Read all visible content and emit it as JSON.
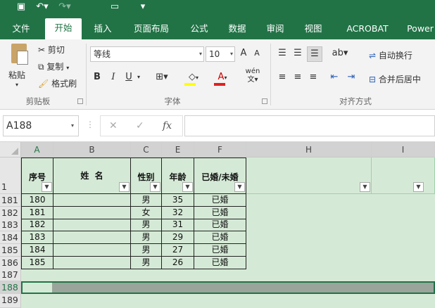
{
  "quick_access": {
    "save_icon": "save-icon",
    "undo_icon": "undo-icon",
    "redo_icon": "redo-icon",
    "camera_icon": "camera-icon",
    "customize_icon": "customize-icon"
  },
  "tabs": [
    "文件",
    "开始",
    "插入",
    "页面布局",
    "公式",
    "数据",
    "审阅",
    "视图",
    "ACROBAT",
    "Power"
  ],
  "active_tab": "开始",
  "ribbon": {
    "clipboard": {
      "group_label": "剪贴板",
      "paste": "粘贴",
      "cut": "剪切",
      "copy": "复制",
      "format_painter": "格式刷"
    },
    "font": {
      "group_label": "字体",
      "font_name": "等线",
      "font_size": "10",
      "grow": "A",
      "shrink": "A",
      "bold": "B",
      "italic": "I",
      "underline": "U",
      "pinyin": "wén"
    },
    "alignment": {
      "group_label": "对齐方式",
      "wrap_text": "自动换行",
      "merge_center": "合并后居中"
    }
  },
  "formula_bar": {
    "name_box": "A188",
    "cancel": "✕",
    "enter": "✓",
    "fx": "fx",
    "value": ""
  },
  "columns": [
    "A",
    "B",
    "C",
    "E",
    "F",
    "H",
    "I"
  ],
  "table": {
    "headers": [
      "序号",
      "姓  名",
      "性别",
      "年龄",
      "已婚/未婚"
    ],
    "header_row_number": "1",
    "rows": [
      {
        "row": "181",
        "num": "180",
        "name": "",
        "gender": "男",
        "age": "35",
        "status": "已婚"
      },
      {
        "row": "182",
        "num": "181",
        "name": "",
        "gender": "女",
        "age": "32",
        "status": "已婚"
      },
      {
        "row": "183",
        "num": "182",
        "name": "",
        "gender": "男",
        "age": "31",
        "status": "已婚"
      },
      {
        "row": "184",
        "num": "183",
        "name": "",
        "gender": "男",
        "age": "29",
        "status": "已婚"
      },
      {
        "row": "185",
        "num": "184",
        "name": "",
        "gender": "男",
        "age": "27",
        "status": "已婚"
      },
      {
        "row": "186",
        "num": "185",
        "name": "",
        "gender": "男",
        "age": "26",
        "status": "已婚"
      }
    ],
    "empty_rows": [
      "187",
      "188",
      "189"
    ],
    "selected_row": "188"
  },
  "colors": {
    "excel_green": "#217346",
    "fill_green": "#d5ead6",
    "selection_gray": "#9aa49b"
  }
}
